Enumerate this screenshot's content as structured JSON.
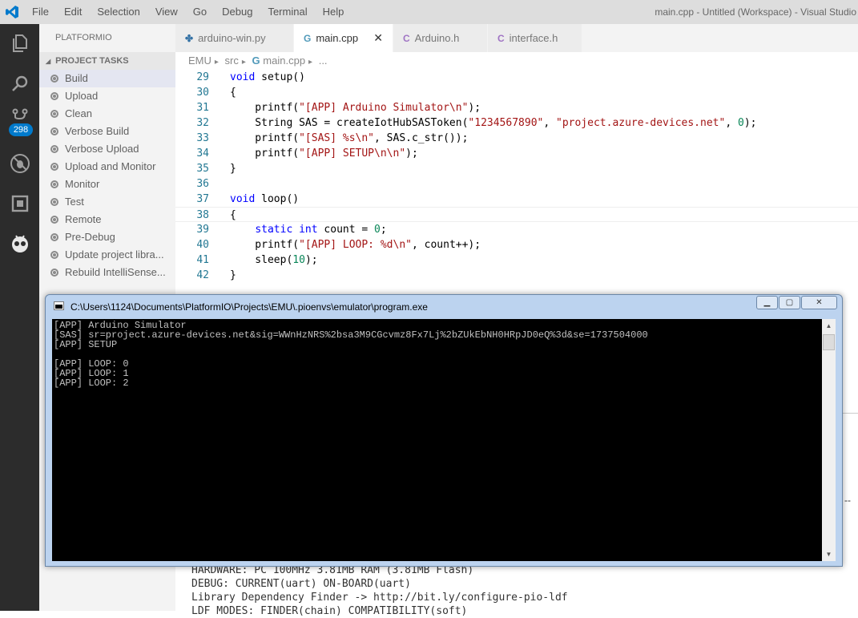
{
  "titlebar": {
    "menu": [
      "File",
      "Edit",
      "Selection",
      "View",
      "Go",
      "Debug",
      "Terminal",
      "Help"
    ],
    "window_title": "main.cpp - Untitled (Workspace) - Visual Studio"
  },
  "activity": {
    "icons": [
      "explorer-icon",
      "search-icon",
      "source-control-icon",
      "debug-icon",
      "extensions-icon",
      "platformio-icon"
    ],
    "badge": "298"
  },
  "sidebar": {
    "title": "PLATFORMIO",
    "section": "PROJECT TASKS",
    "tasks": [
      "Build",
      "Upload",
      "Clean",
      "Verbose Build",
      "Verbose Upload",
      "Upload and Monitor",
      "Monitor",
      "Test",
      "Remote",
      "Pre-Debug",
      "Update project libra...",
      "Rebuild IntelliSense..."
    ]
  },
  "tabs": [
    {
      "label": "arduino-win.py",
      "icon": "python-icon"
    },
    {
      "label": "main.cpp",
      "icon": "cpp-icon",
      "close": "✕"
    },
    {
      "label": "Arduino.h",
      "icon": "c-icon"
    },
    {
      "label": "interface.h",
      "icon": "c-icon"
    }
  ],
  "breadcrumb": {
    "items": [
      "EMU",
      "src",
      "main.cpp",
      "..."
    ]
  },
  "editor": {
    "line_numbers": [
      "29",
      "30",
      "31",
      "32",
      "33",
      "34",
      "35",
      "36",
      "37",
      "38",
      "39",
      "40",
      "41",
      "42"
    ]
  },
  "console": {
    "title": "C:\\Users\\1124\\Documents\\PlatformIO\\Projects\\EMU\\.pioenvs\\emulator\\program.exe",
    "lines": [
      "[APP] Arduino Simulator",
      "[SAS] sr=project.azure-devices.net&sig=WWnHzNRS%2bsa3M9CGcvmz8Fx7Lj%2bZUkEbNH0HRpJD0eQ%3d&se=1737504000",
      "[APP] SETUP",
      "",
      "[APP] LOOP: 0",
      "[APP] LOOP: 1",
      "[APP] LOOP: 2"
    ]
  },
  "terminal": {
    "lines": [
      "HARDWARE: PC 100MHz 3.81MB RAM (3.81MB Flash)",
      "DEBUG: CURRENT(uart) ON-BOARD(uart)",
      "Library Dependency Finder -> http://bit.ly/configure-pio-ldf",
      "LDF MODES: FINDER(chain) COMPATIBILITY(soft)"
    ],
    "right_dash": "--"
  }
}
